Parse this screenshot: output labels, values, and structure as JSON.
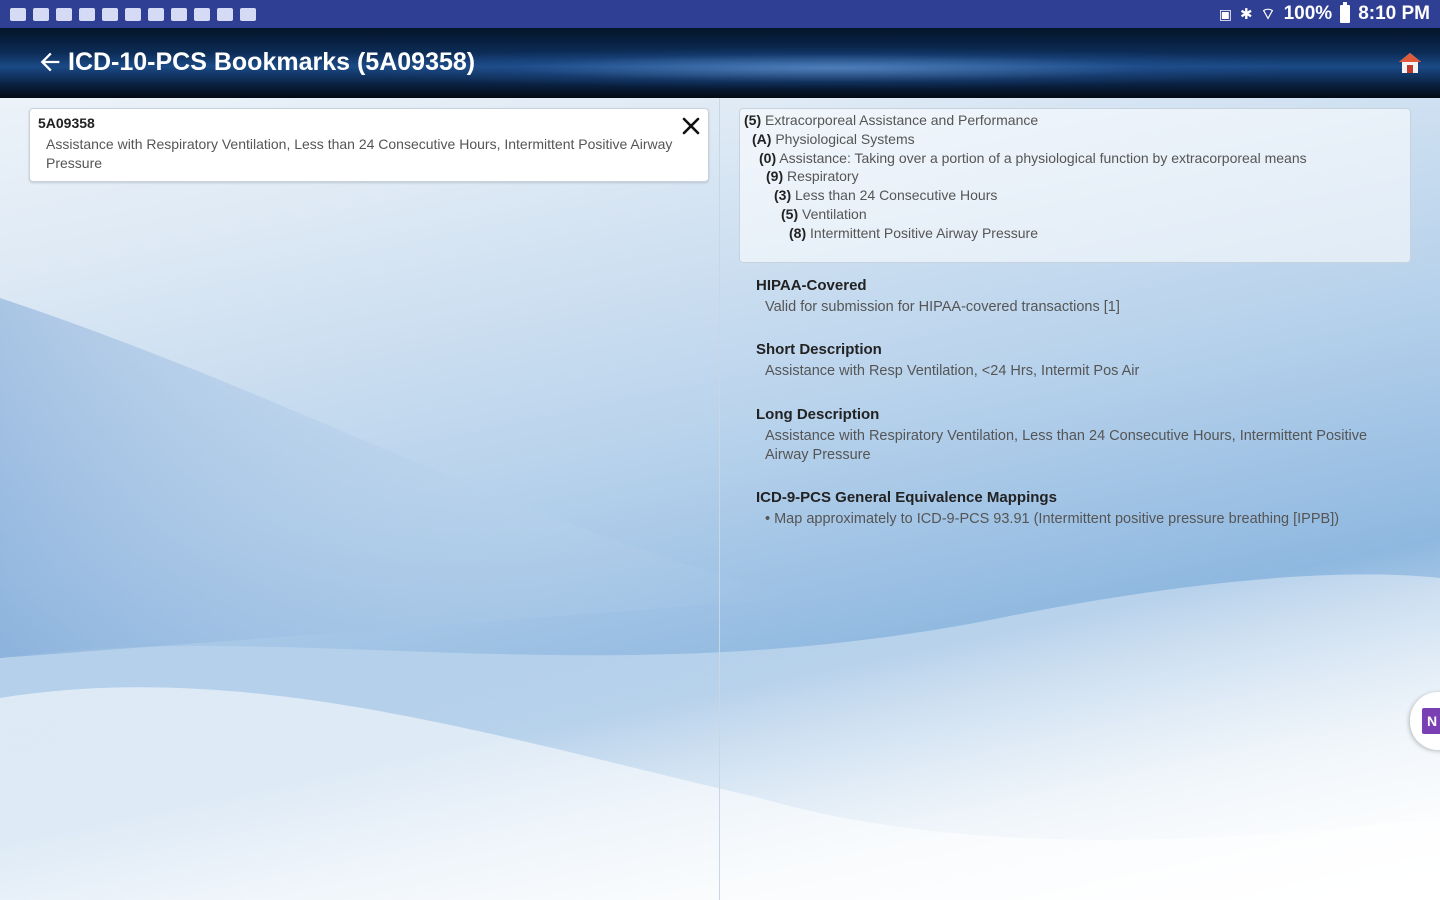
{
  "status_bar": {
    "battery": "100%",
    "time": "8:10 PM"
  },
  "app_bar": {
    "title": "ICD-10-PCS Bookmarks (5A09358)"
  },
  "bookmark": {
    "code": "5A09358",
    "description": "Assistance with Respiratory Ventilation, Less than 24 Consecutive Hours, Intermittent Positive Airway Pressure"
  },
  "hierarchy": [
    {
      "code": "(5)",
      "text": " Extracorporeal Assistance and Performance"
    },
    {
      "code": "(A)",
      "text": " Physiological Systems"
    },
    {
      "code": "(0)",
      "text": " Assistance: Taking over a portion of a physiological function by extracorporeal means"
    },
    {
      "code": "(9)",
      "text": " Respiratory"
    },
    {
      "code": "(3)",
      "text": " Less than 24 Consecutive Hours"
    },
    {
      "code": "(5)",
      "text": " Ventilation"
    },
    {
      "code": "(8)",
      "text": " Intermittent Positive Airway Pressure"
    }
  ],
  "sections": {
    "hipaa_title": "HIPAA-Covered",
    "hipaa_text": "Valid for submission for HIPAA-covered transactions [1]",
    "short_title": "Short Description",
    "short_text": "Assistance with Resp Ventilation, <24 Hrs, Intermit Pos Air",
    "long_title": "Long Description",
    "long_text": "Assistance with Respiratory Ventilation, Less than 24 Consecutive Hours, Intermittent Positive Airway Pressure",
    "gem_title": "ICD-9-PCS General Equivalence Mappings",
    "gem_text": "• Map approximately to ICD-9-PCS 93.91 (Intermittent positive pressure breathing [IPPB])"
  },
  "onenote_badge": "N",
  "colors": {
    "status_bar": "#2f3f93",
    "onenote": "#7b3fb4"
  }
}
